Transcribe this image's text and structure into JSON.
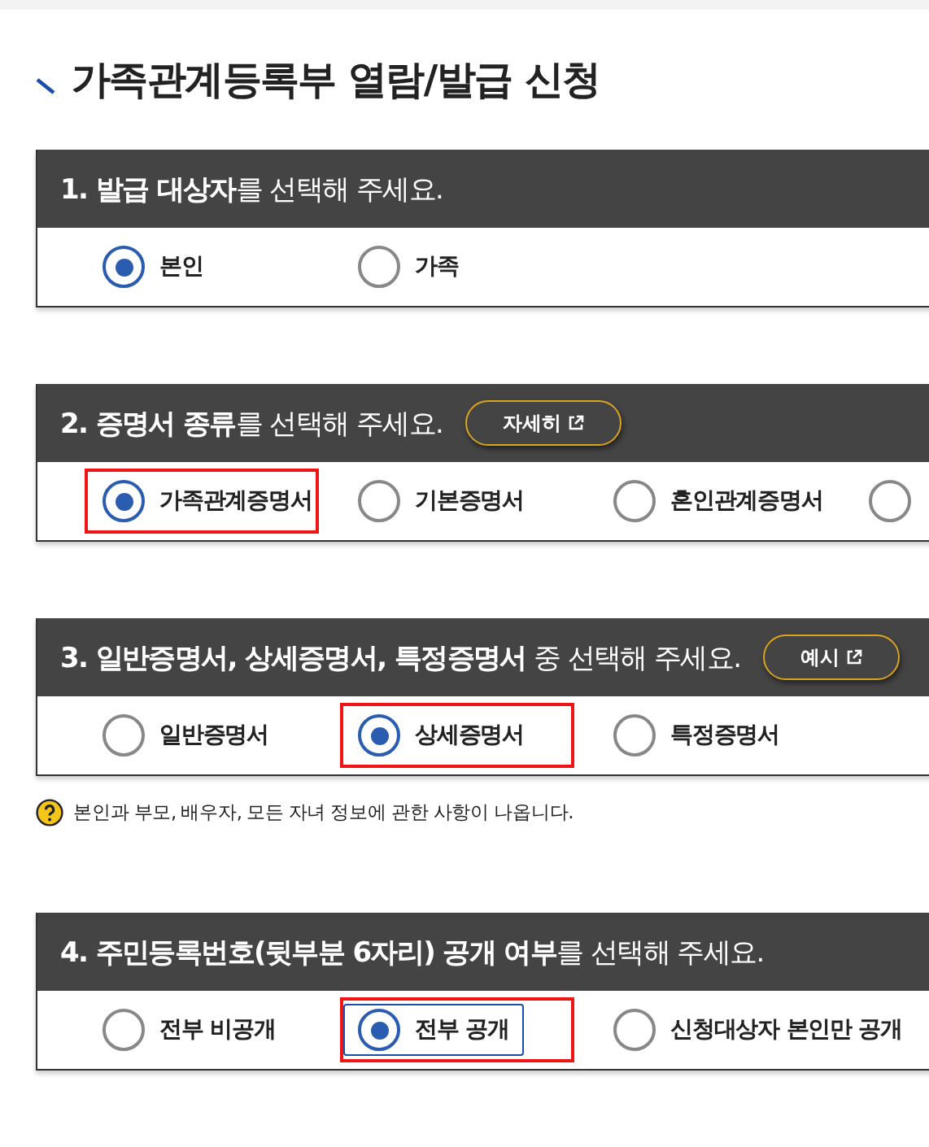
{
  "title": "가족관계등록부 열람/발급 신청",
  "sections": [
    {
      "heading": "**1. 발급 대상자**를 선택해 주세요.",
      "options": [
        {
          "label": "본인",
          "selected": true,
          "highlighted": false,
          "focused": false
        },
        {
          "label": "가족",
          "selected": false,
          "highlighted": false,
          "focused": false
        }
      ]
    },
    {
      "heading": "**2. 증명서 종류**를 선택해 주세요.",
      "button": "자세히",
      "options": [
        {
          "label": "가족관계증명서",
          "selected": true,
          "highlighted": true,
          "focused": false
        },
        {
          "label": "기본증명서",
          "selected": false,
          "highlighted": false,
          "focused": false
        },
        {
          "label": "혼인관계증명서",
          "selected": false,
          "highlighted": false,
          "focused": false
        },
        {
          "selected": false,
          "highlighted": false,
          "focused": false
        }
      ]
    },
    {
      "heading": "**3. 일반증명서, 상세증명서, 특정증명서** 중 선택해 주세요.",
      "button": "예시",
      "options": [
        {
          "label": "일반증명서",
          "selected": false,
          "highlighted": false,
          "focused": false
        },
        {
          "label": "상세증명서",
          "selected": true,
          "highlighted": true,
          "focused": false
        },
        {
          "label": "특정증명서",
          "selected": false,
          "highlighted": false,
          "focused": false
        }
      ],
      "note": "본인과 부모, 배우자, 모든 자녀 정보에 관한 사항이 나옵니다."
    },
    {
      "heading": "**4. 주민등록번호(뒷부분 6자리) 공개 여부**를 선택해 주세요.",
      "options": [
        {
          "label": "전부 비공개",
          "selected": false,
          "highlighted": false,
          "focused": false
        },
        {
          "label": "전부 공개",
          "selected": true,
          "highlighted": true,
          "focused": true
        },
        {
          "label": "신청대상자 본인만 공개",
          "selected": false,
          "highlighted": false,
          "focused": false
        }
      ]
    }
  ]
}
